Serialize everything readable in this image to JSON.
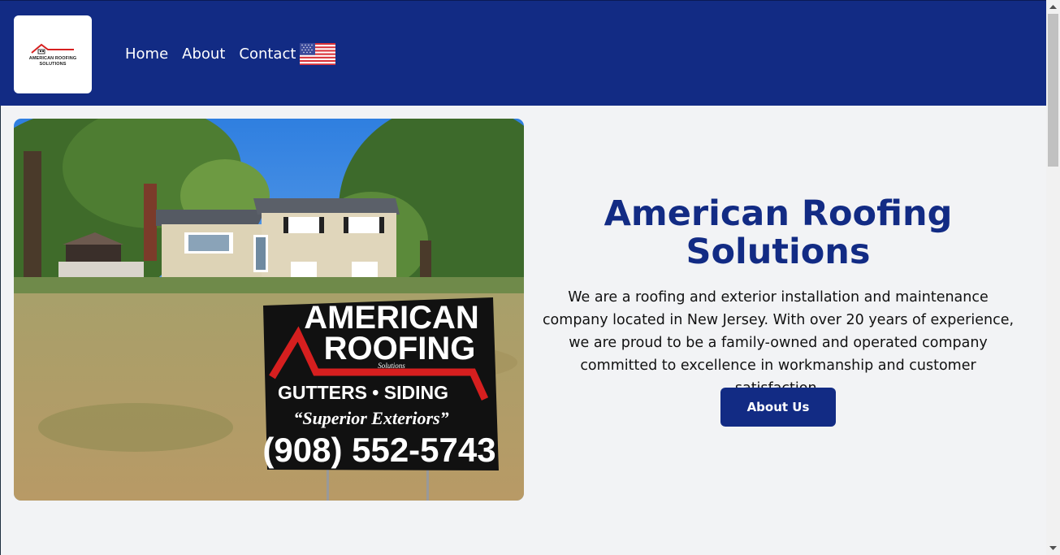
{
  "brand": {
    "logo_line1": "AMERICAN ROOFING",
    "logo_line2": "SOLUTIONS"
  },
  "nav": {
    "items": [
      {
        "label": "Home"
      },
      {
        "label": "About"
      },
      {
        "label": "Contact"
      }
    ],
    "language_icon": "us-flag-icon"
  },
  "hero": {
    "image_sign": {
      "line1": "AMERICAN",
      "line2": "ROOFING",
      "line3": "Solutions",
      "line4": "GUTTERS • SIDING",
      "line5": "“Superior Exteriors”",
      "phone": "(908) 552-5743"
    },
    "title_line1": "American Roofing",
    "title_line2": "Solutions",
    "description": "We are a roofing and exterior installation and maintenance company located in New Jersey. With over 20 years of experience, we are proud to be a family-owned and operated company committed to excellence in workmanship and customer satisfaction.",
    "button_label": "About Us"
  },
  "colors": {
    "primary": "#122b84",
    "background": "#f2f3f5",
    "white": "#ffffff"
  }
}
